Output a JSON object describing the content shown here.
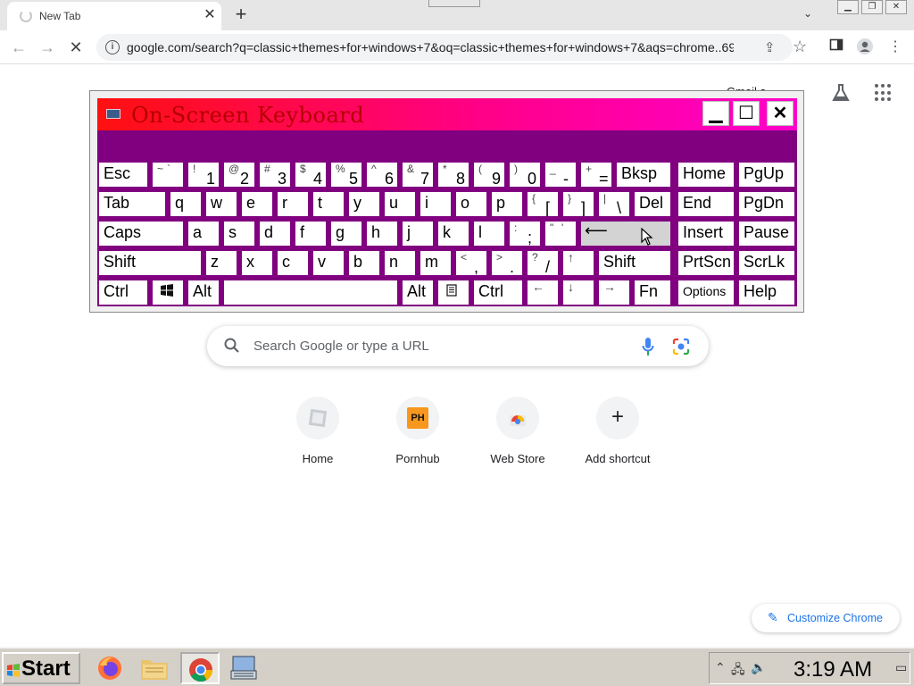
{
  "browser": {
    "tab_title": "New Tab",
    "url": "google.com/search?q=classic+themes+for+windows+7&oq=classic+themes+for+windows+7&aqs=chrome..69..."
  },
  "ntp": {
    "gmail_partial": "Gmail    s",
    "search_placeholder": "Search Google or type a URL",
    "shortcuts": [
      {
        "label": "Home"
      },
      {
        "label": "Pornhub",
        "logo": "PH"
      },
      {
        "label": "Web Store"
      },
      {
        "label": "Add shortcut",
        "symbol": "+"
      }
    ],
    "customize_label": "Customize Chrome"
  },
  "osk": {
    "title": "On-Screen Keyboard",
    "keys": {
      "esc": "Esc",
      "bksp": "Bksp",
      "home": "Home",
      "pgup": "PgUp",
      "tab": "Tab",
      "del": "Del",
      "end": "End",
      "pgdn": "PgDn",
      "caps": "Caps",
      "insert": "Insert",
      "pause": "Pause",
      "shift_l": "Shift",
      "shift_r": "Shift",
      "prtscn": "PrtScn",
      "scrlk": "ScrLk",
      "ctrl_l": "Ctrl",
      "alt_l": "Alt",
      "alt_r": "Alt",
      "ctrl_r": "Ctrl",
      "fn": "Fn",
      "options": "Options",
      "help": "Help",
      "tilde_top": "~",
      "tilde_bot": "`",
      "n1_top": "!",
      "n1_bot": "1",
      "n2_top": "@",
      "n2_bot": "2",
      "n3_top": "#",
      "n3_bot": "3",
      "n4_top": "$",
      "n4_bot": "4",
      "n5_top": "%",
      "n5_bot": "5",
      "n6_top": "^",
      "n6_bot": "6",
      "n7_top": "&",
      "n7_bot": "7",
      "n8_top": "*",
      "n8_bot": "8",
      "n9_top": "(",
      "n9_bot": "9",
      "n0_top": ")",
      "n0_bot": "0",
      "minus_top": "_",
      "minus_bot": "-",
      "eq_top": "+",
      "eq_bot": "=",
      "q": "q",
      "w": "w",
      "e": "e",
      "r": "r",
      "t": "t",
      "y": "y",
      "u": "u",
      "i": "i",
      "o": "o",
      "p": "p",
      "lbr_top": "{",
      "lbr_bot": "[",
      "rbr_top": "}",
      "rbr_bot": "]",
      "bs_top": "|",
      "bs_bot": "\\",
      "a": "a",
      "s": "s",
      "d": "d",
      "f": "f",
      "g": "g",
      "h": "h",
      "j": "j",
      "k": "k",
      "l": "l",
      "semi_top": ":",
      "semi_bot": ";",
      "quote_top": "\"",
      "quote_bot": "'",
      "enter_arrow": "⟵",
      "z": "z",
      "x": "x",
      "c": "c",
      "v": "v",
      "b": "b",
      "n": "n",
      "m": "m",
      "comma_top": "<",
      "comma_bot": ",",
      "period_top": ">",
      "period_bot": ".",
      "slash_top": "?",
      "slash_bot": "/",
      "up": "↑",
      "left": "←",
      "down": "↓",
      "right": "→"
    }
  },
  "taskbar": {
    "start_label": "Start",
    "clock": "3:19 AM"
  },
  "colors": {
    "osk_purple": "#800080",
    "osk_title_start": "#ff1010",
    "osk_title_end": "#ff00cc",
    "chrome_blue": "#1a73e8",
    "taskbar": "#d4d0c8"
  }
}
